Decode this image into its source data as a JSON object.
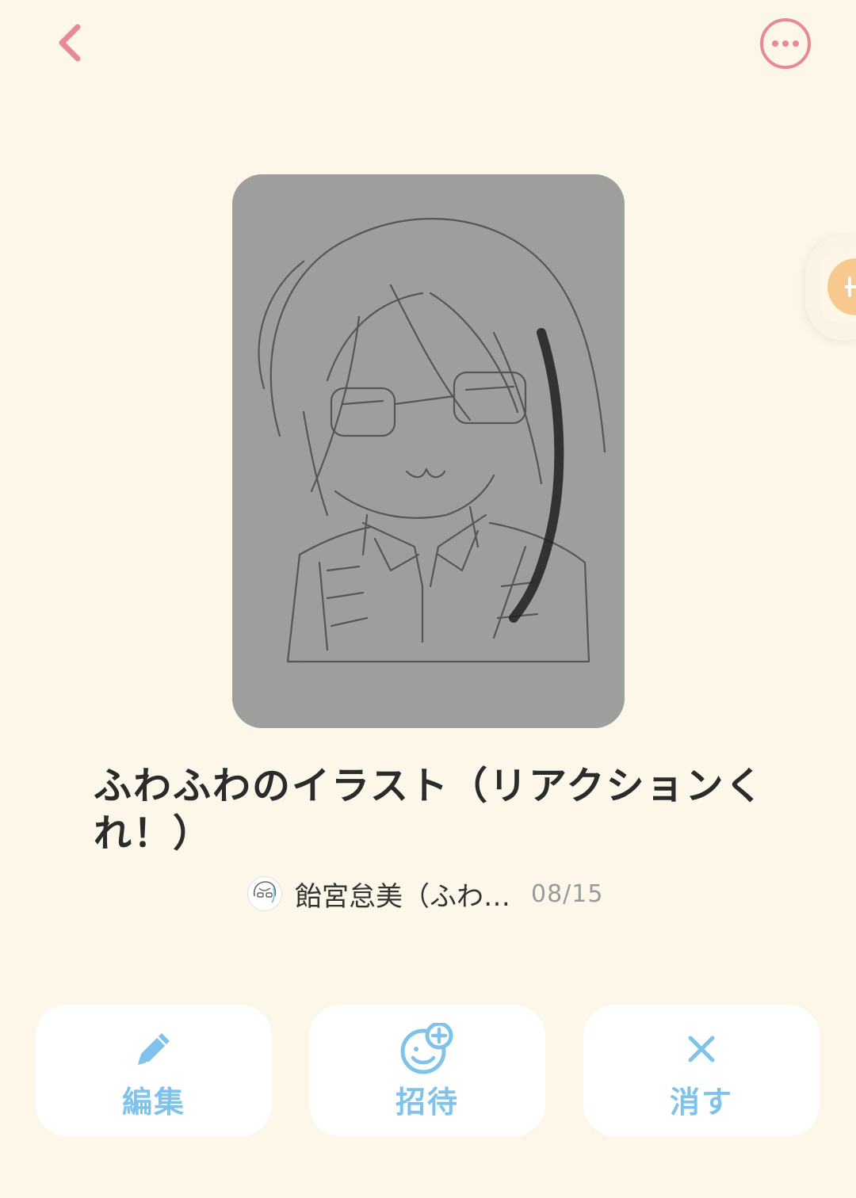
{
  "post": {
    "title": "ふわふわのイラスト（リアクションくれ！）",
    "author": "飴宮怠美（ふわ…",
    "date": "08/15"
  },
  "actions": {
    "edit_label": "編集",
    "invite_label": "招待",
    "delete_label": "消す"
  },
  "icons": {
    "back": "chevron-left-icon",
    "more": "more-options-icon",
    "edit": "pencil-icon",
    "invite": "smile-plus-icon",
    "delete": "close-icon"
  },
  "colors": {
    "background": "#fdf7ea",
    "accent_pink": "#e88a96",
    "action_blue": "#7fc3ea",
    "side_tab": "#f7c98e"
  }
}
